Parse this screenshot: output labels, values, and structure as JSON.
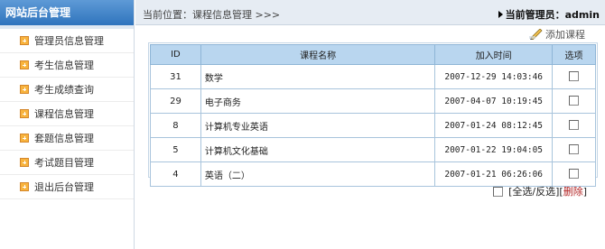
{
  "sidebar": {
    "title": "网站后台管理",
    "items": [
      {
        "label": "管理员信息管理"
      },
      {
        "label": "考生信息管理"
      },
      {
        "label": "考生成绩查询"
      },
      {
        "label": "课程信息管理"
      },
      {
        "label": "套题信息管理"
      },
      {
        "label": "考试题目管理"
      },
      {
        "label": "退出后台管理"
      }
    ]
  },
  "breadcrumb": {
    "location": "当前位置：课程信息管理 >>>",
    "admin": "当前管理员：admin"
  },
  "toolbar": {
    "add_label": "添加课程"
  },
  "table": {
    "headers": {
      "id": "ID",
      "name": "课程名称",
      "time": "加入时间",
      "select": "选项"
    },
    "rows": [
      {
        "id": "31",
        "name": "数学",
        "time": "2007-12-29 14:03:46"
      },
      {
        "id": "29",
        "name": "电子商务",
        "time": "2007-04-07 10:19:45"
      },
      {
        "id": "8",
        "name": "计算机专业英语",
        "time": "2007-01-24 08:12:45"
      },
      {
        "id": "5",
        "name": "计算机文化基础",
        "time": "2007-01-22 19:04:05"
      },
      {
        "id": "4",
        "name": "英语（二）",
        "time": "2007-01-21 06:26:06"
      }
    ]
  },
  "footer": {
    "select_all": "[全选/反选]",
    "delete_open": "[",
    "delete": "删除",
    "delete_close": "]"
  },
  "colors": {
    "sidebar_header": "#2f74bd",
    "table_header": "#b9d6ef",
    "delete_link": "#b22222"
  }
}
